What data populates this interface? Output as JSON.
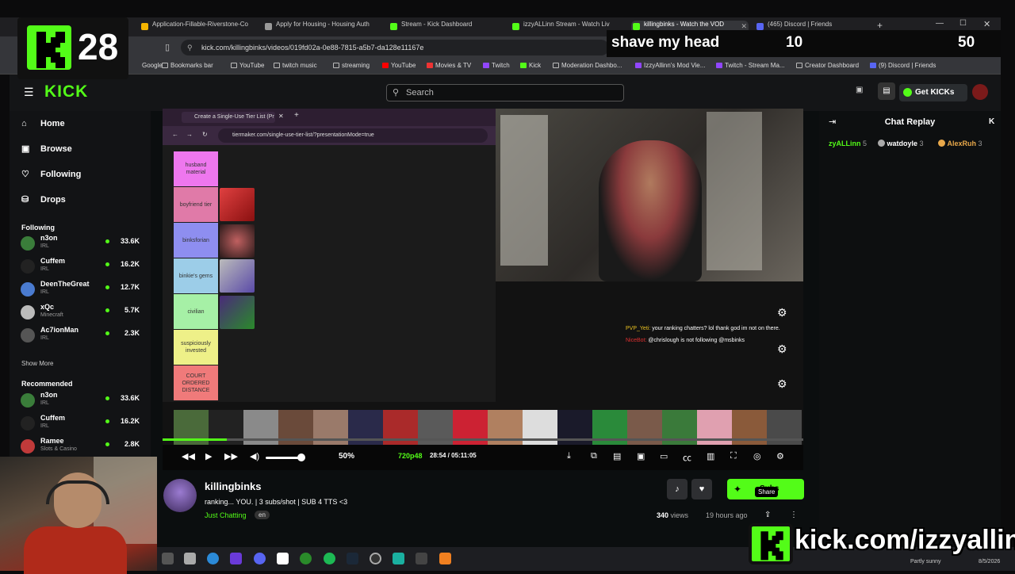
{
  "badge": {
    "count": "28"
  },
  "goal": {
    "title": "shave my head",
    "current": "10",
    "target": "50"
  },
  "browser": {
    "tabs": [
      {
        "label": "Application-Fillable-Riverstone-Co",
        "color": "#f4b400"
      },
      {
        "label": "Apply for Housing - Housing Auth",
        "color": "#999999"
      },
      {
        "label": "Stream - Kick Dashboard",
        "color": "#53fc18"
      },
      {
        "label": "izzyALLinn Stream - Watch Liv",
        "color": "#53fc18"
      },
      {
        "label": "killingbinks - Watch the VOD",
        "color": "#53fc18"
      },
      {
        "label": "(465) Discord | Friends",
        "color": "#5865f2"
      }
    ],
    "url": "kick.com/killingbinks/videos/019fd02a-0e88-7815-a5b7-da128e11167e",
    "bookmarks": [
      "Google",
      "Bookmarks bar",
      "YouTube",
      "twitch music",
      "streaming",
      "YouTube",
      "Movies & TV",
      "Twitch",
      "Kick",
      "Moderation Dashbo...",
      "IzzyAllinn's Mod Vie...",
      "Twitch - Stream Ma...",
      "Creator Dashboard",
      "(9) Discord | Friends"
    ]
  },
  "nav": {
    "search_placeholder": "Search",
    "get_kicks": "Get KICKs",
    "items": [
      "Home",
      "Browse",
      "Following",
      "Drops"
    ]
  },
  "sidebar": {
    "following_title": "Following",
    "following": [
      {
        "name": "n3on",
        "cat": "IRL",
        "viewers": "33.6K",
        "color": "#3a7d3a"
      },
      {
        "name": "Cuffem",
        "cat": "IRL",
        "viewers": "16.2K",
        "color": "#222222"
      },
      {
        "name": "DeenTheGreat",
        "cat": "IRL",
        "viewers": "12.7K",
        "color": "#4a7bd0"
      },
      {
        "name": "xQc",
        "cat": "Minecraft",
        "viewers": "5.7K",
        "color": "#bbbbbb"
      },
      {
        "name": "Ac7ionMan",
        "cat": "IRL",
        "viewers": "2.3K",
        "color": "#555555"
      }
    ],
    "show_more": "Show More",
    "recommended_title": "Recommended",
    "recommended": [
      {
        "name": "n3on",
        "cat": "IRL",
        "viewers": "33.6K",
        "color": "#3a7d3a"
      },
      {
        "name": "Cuffem",
        "cat": "IRL",
        "viewers": "16.2K",
        "color": "#222222"
      },
      {
        "name": "Ramee",
        "cat": "Slots & Casino",
        "viewers": "2.8K",
        "color": "#c03a3a"
      }
    ]
  },
  "tierlist": {
    "tab_title": "Create a Single-Use Tier List (Pr",
    "url": "tiermaker.com/single-use-tier-list/?presentationMode=true",
    "rows": [
      {
        "label": "husband material",
        "color": "#ee77ee"
      },
      {
        "label": "boyfriend tier",
        "color": "#e07aa8"
      },
      {
        "label": "binksforian",
        "color": "#8e8ef0"
      },
      {
        "label": "binkie's gems",
        "color": "#9ccde8"
      },
      {
        "label": "civilian",
        "color": "#a6f0a6"
      },
      {
        "label": "suspiciously invested",
        "color": "#eef088"
      },
      {
        "label": "COURT ORDERED DISTANCE",
        "color": "#f07a7a"
      }
    ]
  },
  "overlay_chat": [
    {
      "user": "PVP_Yeti:",
      "msg": " your ranking chatters? lol thank god im not on there."
    },
    {
      "user": "NiceBot:",
      "msg": " @chrislough is not following @msbinks"
    }
  ],
  "player": {
    "progress": 0.1,
    "zoom": "50%",
    "quality": "720p48",
    "time": "28:54 / 05:11:05"
  },
  "stream": {
    "channel": "killingbinks",
    "title": "ranking... YOU. | 3 subs/shot | SUB 4 TTS <3",
    "category": "Just Chatting",
    "language": "en",
    "views_count": "340",
    "views_label": "views",
    "ago": "19 hours ago",
    "subs_label": "Subs",
    "share_tip": "Share"
  },
  "chat": {
    "title": "Chat Replay",
    "gifters": [
      {
        "name": "zyALLinn",
        "count": "5",
        "color": "#53fc18"
      },
      {
        "name": "watdoyle",
        "count": "3",
        "color": "#ffffff"
      },
      {
        "name": "AlexRuh",
        "count": "3",
        "color": "#e8a84a"
      }
    ]
  },
  "promo": {
    "url": "kick.com/izzyallinn"
  },
  "taskbar": {
    "weather": "Partly sunny",
    "date": "8/5/2026"
  }
}
